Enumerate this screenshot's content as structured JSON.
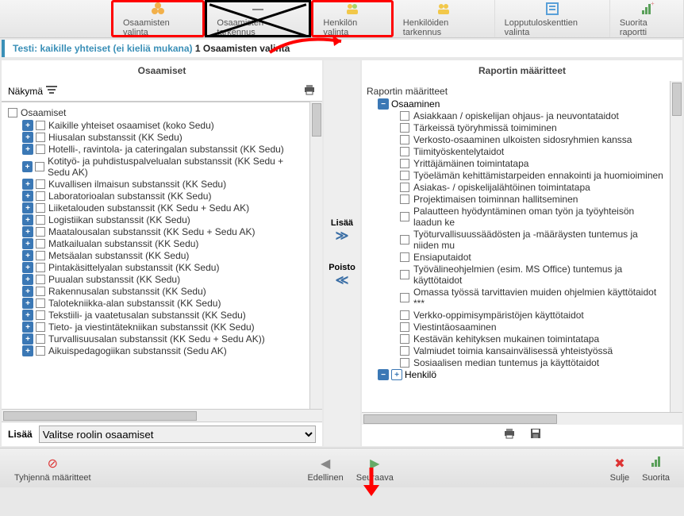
{
  "toolbar": {
    "items": [
      {
        "label": "Osaamisten valinta"
      },
      {
        "label": "Osaamisten tarkennus"
      },
      {
        "label": "Henkilön valinta"
      },
      {
        "label": "Henkilöiden tarkennus"
      },
      {
        "label": "Lopputuloskenttien valinta"
      },
      {
        "label": "Suorita raportti"
      }
    ]
  },
  "breadcrumb": {
    "test_label": "Testi: kaikille yhteiset (ei kieliä mukana)",
    "step": "1 Osaamisten valinta"
  },
  "left": {
    "title": "Osaamiset",
    "view_label": "Näkymä",
    "root": "Osaamiset",
    "items": [
      "Kaikille yhteiset osaamiset (koko Sedu)",
      "Hiusalan substanssit (KK Sedu)",
      "Hotelli-, ravintola- ja cateringalan substanssit (KK Sedu)",
      "Kotityö- ja puhdistuspalvelualan substanssit (KK Sedu + Sedu AK)",
      "Kuvallisen ilmaisun substanssit (KK Sedu)",
      "Laboratorioalan substanssit (KK Sedu)",
      "Liiketalouden substanssit (KK Sedu + Sedu AK)",
      "Logistiikan substanssit (KK Sedu)",
      "Maatalousalan substanssit (KK Sedu + Sedu AK)",
      "Matkailualan substanssit (KK Sedu)",
      "Metsäalan substanssit (KK Sedu)",
      "Pintakäsittelyalan substanssit (KK Sedu)",
      "Puualan substanssit (KK Sedu)",
      "Rakennusalan substanssit (KK Sedu)",
      "Talotekniikka-alan substanssit (KK Sedu)",
      "Tekstiili- ja vaatetusalan substanssit (KK Sedu)",
      "Tieto- ja viestintätekniikan substanssit (KK Sedu)",
      "Turvallisuusalan substanssit (KK Sedu + Sedu AK))",
      "Aikuispedagogiikan substanssit (Sedu AK)"
    ],
    "lisaa_label": "Lisää",
    "lisaa_select": "Valitse roolin osaamiset"
  },
  "mid": {
    "add": "Lisää",
    "remove": "Poisto"
  },
  "right": {
    "title": "Raportin määritteet",
    "root": "Raportin määritteet",
    "sub": "Osaaminen",
    "items": [
      "Asiakkaan / opiskelijan ohjaus- ja neuvontataidot",
      "Tärkeissä työryhmissä toimiminen",
      "Verkosto-osaaminen ulkoisten sidosryhmien kanssa",
      "Tiimityöskentelytaidot",
      "Yrittäjämäinen toimintatapa",
      "Työelämän kehittämistarpeiden ennakointi ja huomioiminen",
      "Asiakas- / opiskelijalähtöinen toimintatapa",
      "Projektimaisen toiminnan hallitseminen",
      "Palautteen hyödyntäminen oman työn ja työyhteisön laadun ke",
      "Työturvallisuussäädösten ja -määräysten tuntemus ja niiden mu",
      "Ensiaputaidot",
      "Työvälineohjelmien (esim. MS Office) tuntemus ja käyttötaidot",
      "Omassa työssä tarvittavien muiden ohjelmien käyttötaidot ***",
      "Verkko-oppimisympäristöjen käyttötaidot",
      "Viestintäosaaminen",
      "Kestävän kehityksen mukainen toimintatapa",
      "Valmiudet toimia kansainvälisessä yhteistyössä",
      "Sosiaalisen median tuntemus ja käyttötaidot"
    ],
    "sub2": "Henkilö"
  },
  "footer": {
    "clear": "Tyhjennä määritteet",
    "prev": "Edellinen",
    "next": "Seuraava",
    "close": "Sulje",
    "run": "Suorita"
  }
}
